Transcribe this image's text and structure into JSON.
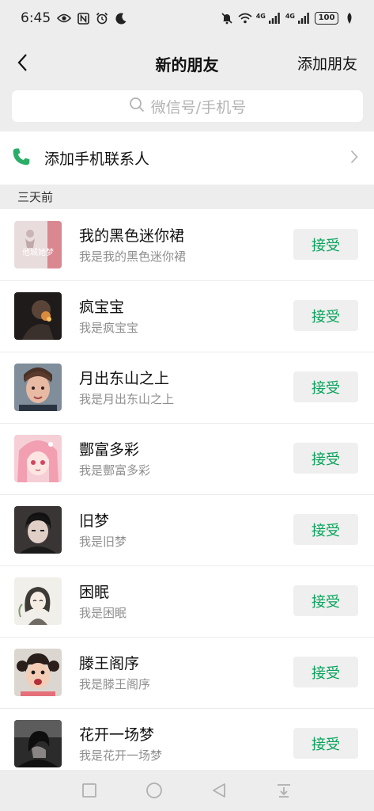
{
  "status_bar": {
    "time": "6:45",
    "network_1": "4G",
    "network_2": "4G",
    "battery": "100",
    "left_icons": [
      "eye-icon",
      "nfc-icon",
      "alarm-icon",
      "moon-icon"
    ],
    "right_icons": [
      "mute-icon",
      "wifi-icon",
      "signal-icon",
      "signal-icon",
      "battery-icon",
      "leaf-icon"
    ]
  },
  "nav": {
    "back_icon": "chevron-left-icon",
    "title": "新的朋友",
    "action": "添加朋友"
  },
  "search": {
    "icon": "search-icon",
    "placeholder": "微信号/手机号"
  },
  "add_contacts": {
    "icon": "phone-icon",
    "label": "添加手机联系人",
    "accent": "#2aae67"
  },
  "section": {
    "label": "三天前"
  },
  "requests": [
    {
      "name": "我的黑色迷你裙",
      "message": "我是我的黑色迷你裙",
      "button": "接受",
      "avatar_text": "他城她梦"
    },
    {
      "name": "疯宝宝",
      "message": "我是疯宝宝",
      "button": "接受"
    },
    {
      "name": "月出东山之上",
      "message": "我是月出东山之上",
      "button": "接受"
    },
    {
      "name": "酆富多彩",
      "message": "我是酆富多彩",
      "button": "接受"
    },
    {
      "name": "旧梦",
      "message": "我是旧梦",
      "button": "接受"
    },
    {
      "name": "困眠",
      "message": "我是困眠",
      "button": "接受"
    },
    {
      "name": "滕王阁序",
      "message": "我是滕王阁序",
      "button": "接受"
    },
    {
      "name": "花开一场梦",
      "message": "我是花开一场梦",
      "button": "接受"
    }
  ],
  "colors": {
    "accept_text": "#07a35a",
    "accept_bg": "#efefef",
    "page_bg": "#ededed"
  },
  "system_nav": [
    "square-icon",
    "circle-icon",
    "triangle-back-icon",
    "notification-down-icon"
  ]
}
